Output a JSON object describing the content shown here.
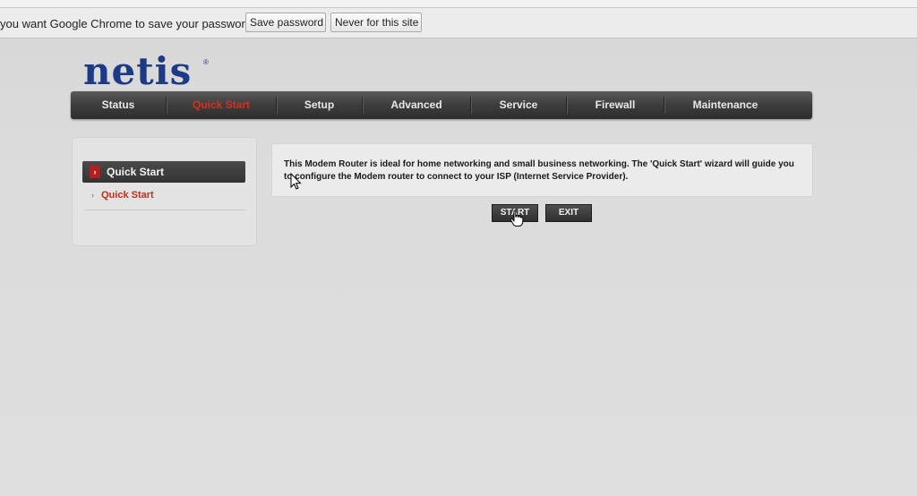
{
  "browser": {
    "password_prompt": "you want Google Chrome to save your password?",
    "save_password_label": "Save password",
    "never_label": "Never for this site"
  },
  "router": {
    "logo_text": "netis",
    "logo_mark": "®",
    "nav": [
      {
        "label": "Status",
        "active": false
      },
      {
        "label": "Quick Start",
        "active": true
      },
      {
        "label": "Setup",
        "active": false
      },
      {
        "label": "Advanced",
        "active": false
      },
      {
        "label": "Service",
        "active": false
      },
      {
        "label": "Firewall",
        "active": false
      },
      {
        "label": "Maintenance",
        "active": false
      }
    ],
    "sidebar": {
      "heading": "Quick Start",
      "heading_icon": "chevron-right-icon",
      "link": "Quick Start",
      "link_icon": "small-chevron-icon"
    },
    "intro_text": "This Modem Router is ideal for home networking and small business networking. The 'Quick Start' wizard will guide you to configure the Modem router to connect to your ISP (Internet Service Provider).",
    "start_label": "START",
    "exit_label": "EXIT"
  },
  "colors": {
    "brand_blue": "#1d3a86",
    "active_red": "#d6301e",
    "nav_dark": "#3d3d3d"
  }
}
